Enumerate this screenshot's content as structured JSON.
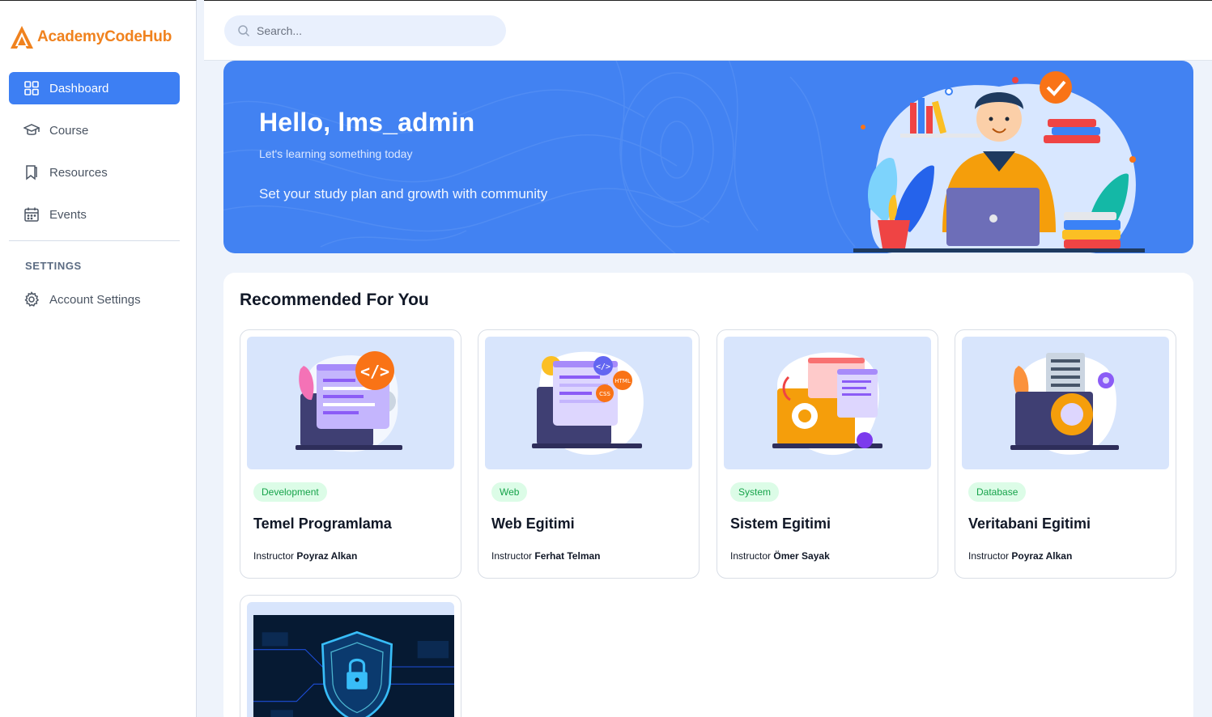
{
  "brand": {
    "name": "AcademyCodeHub",
    "color": "#f0821e"
  },
  "search": {
    "placeholder": "Search..."
  },
  "sidebar": {
    "items": [
      {
        "label": "Dashboard",
        "icon": "grid-icon",
        "active": true
      },
      {
        "label": "Course",
        "icon": "graduation-cap-icon"
      },
      {
        "label": "Resources",
        "icon": "bookmark-icon"
      },
      {
        "label": "Events",
        "icon": "calendar-icon"
      }
    ],
    "settings_heading": "SETTINGS",
    "settings_items": [
      {
        "label": "Account Settings",
        "icon": "gear-icon"
      }
    ]
  },
  "hero": {
    "title": "Hello, lms_admin",
    "subtitle": "Let's learning something today",
    "tagline": "Set your study plan and growth with community"
  },
  "recommended": {
    "title": "Recommended For You",
    "instructor_prefix": "Instructor",
    "courses": [
      {
        "category": "Development",
        "title": "Temel Programlama",
        "instructor": "Poyraz Alkan"
      },
      {
        "category": "Web",
        "title": "Web Egitimi",
        "instructor": "Ferhat Telman"
      },
      {
        "category": "System",
        "title": "Sistem Egitimi",
        "instructor": "Ömer Sayak"
      },
      {
        "category": "Database",
        "title": "Veritabani Egitimi",
        "instructor": "Poyraz Alkan"
      }
    ]
  },
  "colors": {
    "accent": "#3d7ff3",
    "hero_bg": "#4282f2",
    "badge_bg": "#dcfce7",
    "badge_text": "#16a34a"
  }
}
